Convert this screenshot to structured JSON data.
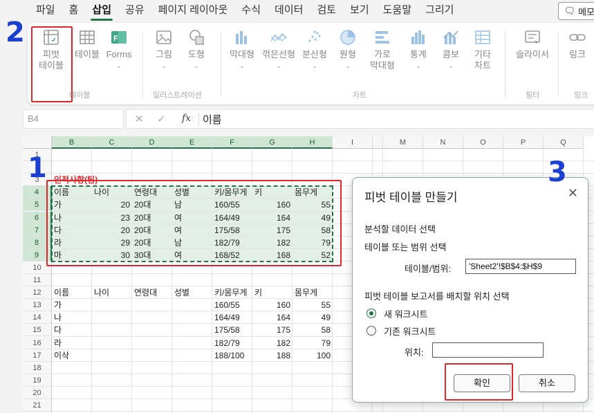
{
  "menubar": {
    "tabs": [
      "파일",
      "홈",
      "삽입",
      "공유",
      "페이지 레이아웃",
      "수식",
      "데이터",
      "검토",
      "보기",
      "도움말",
      "그리기"
    ],
    "active_tab": "삽입",
    "memo_label": "메모"
  },
  "ribbon": {
    "pivot_line1": "피벗",
    "pivot_line2": "테이블",
    "table": "테이블",
    "forms": "Forms",
    "group_tables": "테이블",
    "image": "그림",
    "shapes": "도형",
    "group_illustrations": "일러스트레이션",
    "bar": "막대형",
    "line": "꺾은선형",
    "scatter": "분산형",
    "pie": "원형",
    "hbar_line1": "가로",
    "hbar_line2": "막대형",
    "stat": "통계",
    "combo": "콤보",
    "other_line1": "기타",
    "other_line2": "차트",
    "group_charts": "차트",
    "slicer": "슬라이서",
    "group_filter": "필터",
    "link": "링크",
    "group_link": "링크"
  },
  "formula_bar": {
    "name_box": "B4",
    "fx": "fx",
    "content": "이름"
  },
  "sheet": {
    "columns": [
      "B",
      "C",
      "D",
      "E",
      "F",
      "G",
      "H",
      "I",
      "M",
      "N",
      "O",
      "P",
      "Q"
    ],
    "rows": [
      "1",
      "2",
      "3",
      "4",
      "5",
      "6",
      "7",
      "8",
      "9",
      "10",
      "11",
      "12",
      "13",
      "14",
      "15",
      "16",
      "17",
      "18",
      "19",
      "20",
      "21",
      "22"
    ],
    "note_title": "인적사항(팀)",
    "table1_header": [
      "이름",
      "나이",
      "연령대",
      "성별",
      "키/몸무게",
      "키",
      "몸무게"
    ],
    "table1_rows": [
      [
        "가",
        "20",
        "20대",
        "남",
        "160/55",
        "160",
        "55"
      ],
      [
        "나",
        "23",
        "20대",
        "여",
        "164/49",
        "164",
        "49"
      ],
      [
        "다",
        "20",
        "20대",
        "여",
        "175/58",
        "175",
        "58"
      ],
      [
        "라",
        "29",
        "20대",
        "남",
        "182/79",
        "182",
        "79"
      ],
      [
        "마",
        "30",
        "30대",
        "여",
        "168/52",
        "168",
        "52"
      ]
    ],
    "table2_header": [
      "이름",
      "나이",
      "연령대",
      "성별",
      "키/몸무게",
      "키",
      "몸무게"
    ],
    "table2_rows": [
      [
        "가",
        "",
        "",
        "",
        "160/55",
        "160",
        "55"
      ],
      [
        "나",
        "",
        "",
        "",
        "164/49",
        "164",
        "49"
      ],
      [
        "다",
        "",
        "",
        "",
        "175/58",
        "175",
        "58"
      ],
      [
        "라",
        "",
        "",
        "",
        "182/79",
        "182",
        "79"
      ],
      [
        "이삭",
        "",
        "",
        "",
        "188/100",
        "188",
        "100"
      ]
    ]
  },
  "dialog": {
    "title": "피벗 테이블 만들기",
    "close": "✕",
    "section1": "분석할 데이터 선택",
    "option_table": "테이블 또는 범위 선택",
    "range_label": "테이블/범위:",
    "range_value": "'Sheet2'!$B$4:$H$9",
    "section2": "피벗 테이블 보고서를 배치할 위치 선택",
    "radio_new": "새 워크시트",
    "radio_existing": "기존 워크시트",
    "location_label": "위치:",
    "location_value": "",
    "ok": "확인",
    "cancel": "취소"
  },
  "annotations": [
    "1",
    "2",
    "3"
  ],
  "colors": {
    "accent": "#217346",
    "highlight_red": "#e0262b",
    "annotation_blue": "#1a3fd1"
  }
}
